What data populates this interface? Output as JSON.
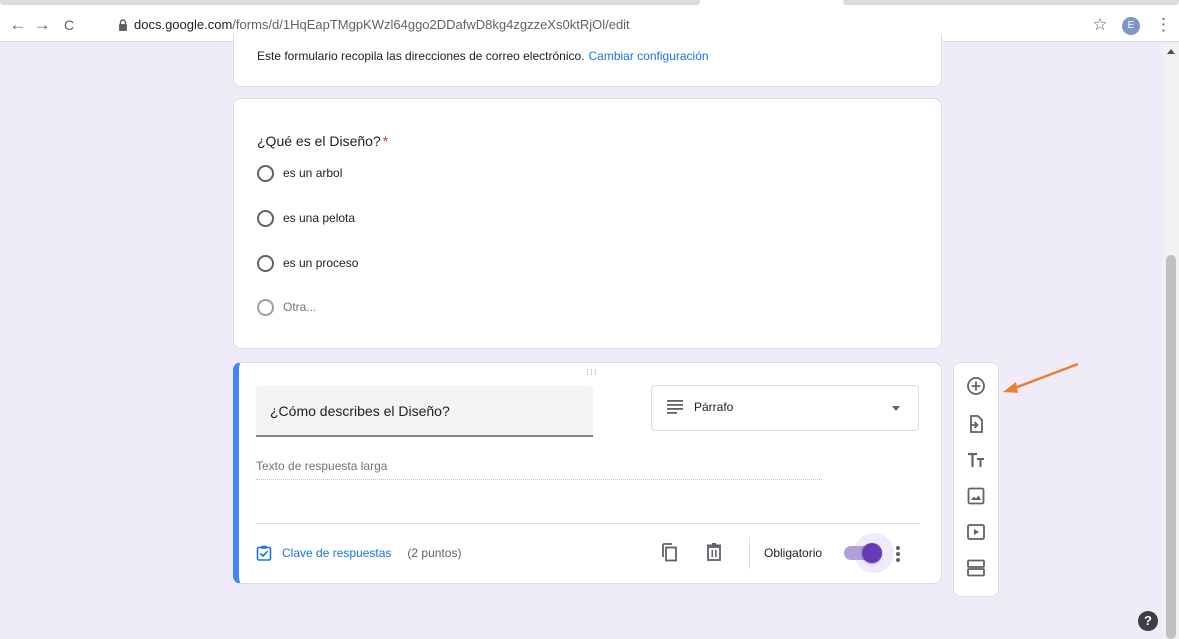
{
  "browser": {
    "url_domain": "docs.google.com",
    "url_path": "/forms/d/1HqEapTMgpKWzl64ggo2DDafwD8kg4zgzzeXs0ktRjOl/edit",
    "back_glyph": "←",
    "forward_glyph": "→",
    "reload_glyph": "C",
    "star_glyph": "☆",
    "profile_initial": "E",
    "menu_glyph": "⋮",
    "profile_color": "#7e97c6"
  },
  "form": {
    "email_notice": "Este formulario recopila las direcciones de correo electrónico.",
    "email_settings_link": "Cambiar configuración",
    "question1": {
      "title": "¿Qué es el Diseño?",
      "required_mark": "*",
      "options": [
        {
          "label": "es un arbol"
        },
        {
          "label": "es una pelota"
        },
        {
          "label": "es un proceso"
        },
        {
          "label": "Otra..."
        }
      ]
    },
    "question2": {
      "title": "¿Cómo describes el Diseño?",
      "type_label": "Párrafo",
      "placeholder": "Texto de respuesta larga",
      "answer_key_label": "Clave de respuestas",
      "points": "(2 puntos)",
      "required_label": "Obligatorio",
      "required_on": true,
      "drag_glyph": "⁝⁝⁝"
    }
  },
  "side_toolbar": {
    "items": [
      "add-question",
      "import-questions",
      "add-title",
      "add-image",
      "add-video",
      "add-section"
    ]
  },
  "help_glyph": "?",
  "colors": {
    "accent_purple": "#673ab7",
    "accent_blue": "#4285f4",
    "link_blue": "#1a73e8",
    "required_red": "#d93025",
    "annotation_arrow": "#ed7d31",
    "page_bg": "#f0ebf8"
  }
}
